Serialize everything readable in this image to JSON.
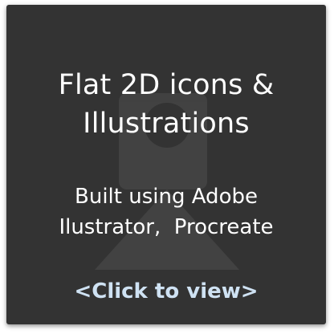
{
  "card": {
    "title_line1": "Flat 2D icons &",
    "title_line2": "Illustrations",
    "subtitle_line1": "Built using Adobe",
    "subtitle_line2": "Ilustrator,  Procreate",
    "cta_label": "<Click to view>"
  },
  "colors": {
    "card_background": "#333333",
    "text": "#ffffff",
    "cta": "#cfe2f3"
  }
}
